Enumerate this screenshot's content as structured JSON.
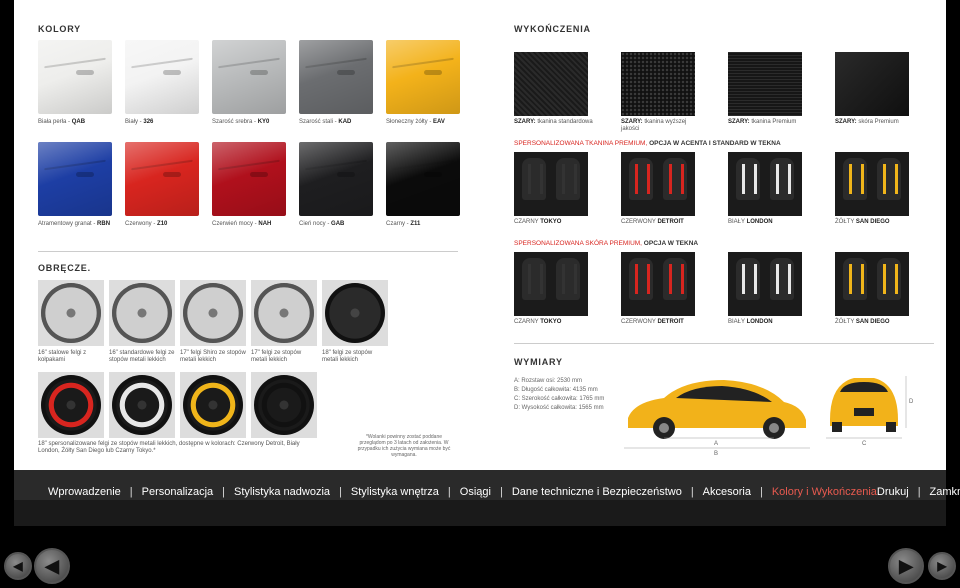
{
  "colors_section": {
    "title": "KOLORY",
    "swatches": [
      {
        "name": "Biała perła",
        "code": "QAB",
        "color": "#eeeeec"
      },
      {
        "name": "Biały",
        "code": "326",
        "color": "#f3f3f3"
      },
      {
        "name": "Szarość srebra",
        "code": "KY0",
        "color": "#b9bbbc"
      },
      {
        "name": "Szarość stali",
        "code": "KAD",
        "color": "#6b6d70"
      },
      {
        "name": "Słoneczny żółty",
        "code": "EAV",
        "color": "#f3b21a"
      },
      {
        "name": "Atramentowy granat",
        "code": "RBN",
        "color": "#1d3ea4"
      },
      {
        "name": "Czerwony",
        "code": "Z10",
        "color": "#d8251f"
      },
      {
        "name": "Czerwień mocy",
        "code": "NAH",
        "color": "#b0101c"
      },
      {
        "name": "Cień nocy",
        "code": "GAB",
        "color": "#1e1e20"
      },
      {
        "name": "Czarny",
        "code": "Z11",
        "color": "#0b0b0b"
      }
    ]
  },
  "wheels_section": {
    "title": "OBRĘCZE.",
    "row1": [
      "16\" stalowe felgi z kołpakami",
      "16\" standardowe felgi ze stopów metali lekkich",
      "17\" felgi Shiro ze stopów metali lekkich",
      "17\" felgi ze stopów metali lekkich",
      "18\" felgi ze stopów metali lekkich"
    ],
    "row2_caption": "18\" spersonalizowane felgi ze stopów metali lekkich, dostępne w kolorach: Czerwony Detroit, Biały London, Żółty San Diego lub Czarny Tokyo.*",
    "trim_colors": [
      "#d8251f",
      "#e8e8e8",
      "#f0b51a",
      "#111111"
    ],
    "note": "*Wolanki powinny zostać poddane przeglądom po 3 latach od założenia. W przypadku ich zużycia wymiana może być wymagana."
  },
  "finishes_section": {
    "title": "WYKOŃCZENIA",
    "fabrics": [
      {
        "label": "SZARY:",
        "desc": "tkanina standardowa"
      },
      {
        "label": "SZARY:",
        "desc": "tkanina wyższej jakości"
      },
      {
        "label": "SZARY:",
        "desc": "tkanina Premium"
      },
      {
        "label": "SZARY:",
        "desc": "skóra Premium"
      }
    ],
    "fabric_premium_title": "SPERSONALIZOWANA TKANINA PREMIUM,",
    "fabric_premium_title_rest": "OPCJA W ACENTA I STANDARD W TEKNA",
    "leather_premium_title": "SPERSONALIZOWANA SKÓRA PREMIUM,",
    "leather_premium_title_rest": "OPCJA W TEKNA",
    "seat_variants": [
      {
        "prefix": "CZARNY",
        "name": "TOKYO",
        "trim": "#333333"
      },
      {
        "prefix": "CZERWONY",
        "name": "DETROIT",
        "trim": "#d8251f"
      },
      {
        "prefix": "BIAŁY",
        "name": "LONDON",
        "trim": "#e8e8e8"
      },
      {
        "prefix": "ŻÓŁTY",
        "name": "SAN DIEGO",
        "trim": "#f0b51a"
      }
    ]
  },
  "dimensions_section": {
    "title": "WYMIARY",
    "lines": [
      "A: Rozstaw osi: 2530 mm",
      "B: Długość całkowita: 4135 mm",
      "C: Szerokość całkowita: 1765 mm",
      "D: Wysokość całkowita: 1565 mm"
    ],
    "label_a": "A",
    "label_b": "B",
    "label_c": "C",
    "label_d": "D",
    "car_color": "#f2b21a"
  },
  "nav": {
    "items": [
      "Wprowadzenie",
      "Personalizacja",
      "Stylistyka nadwozia",
      "Stylistyka wnętrza",
      "Osiągi",
      "Dane techniczne i Bezpieczeństwo",
      "Akcesoria",
      "Kolory i Wykończenia"
    ],
    "right": [
      "Drukuj",
      "Zamknij"
    ]
  }
}
